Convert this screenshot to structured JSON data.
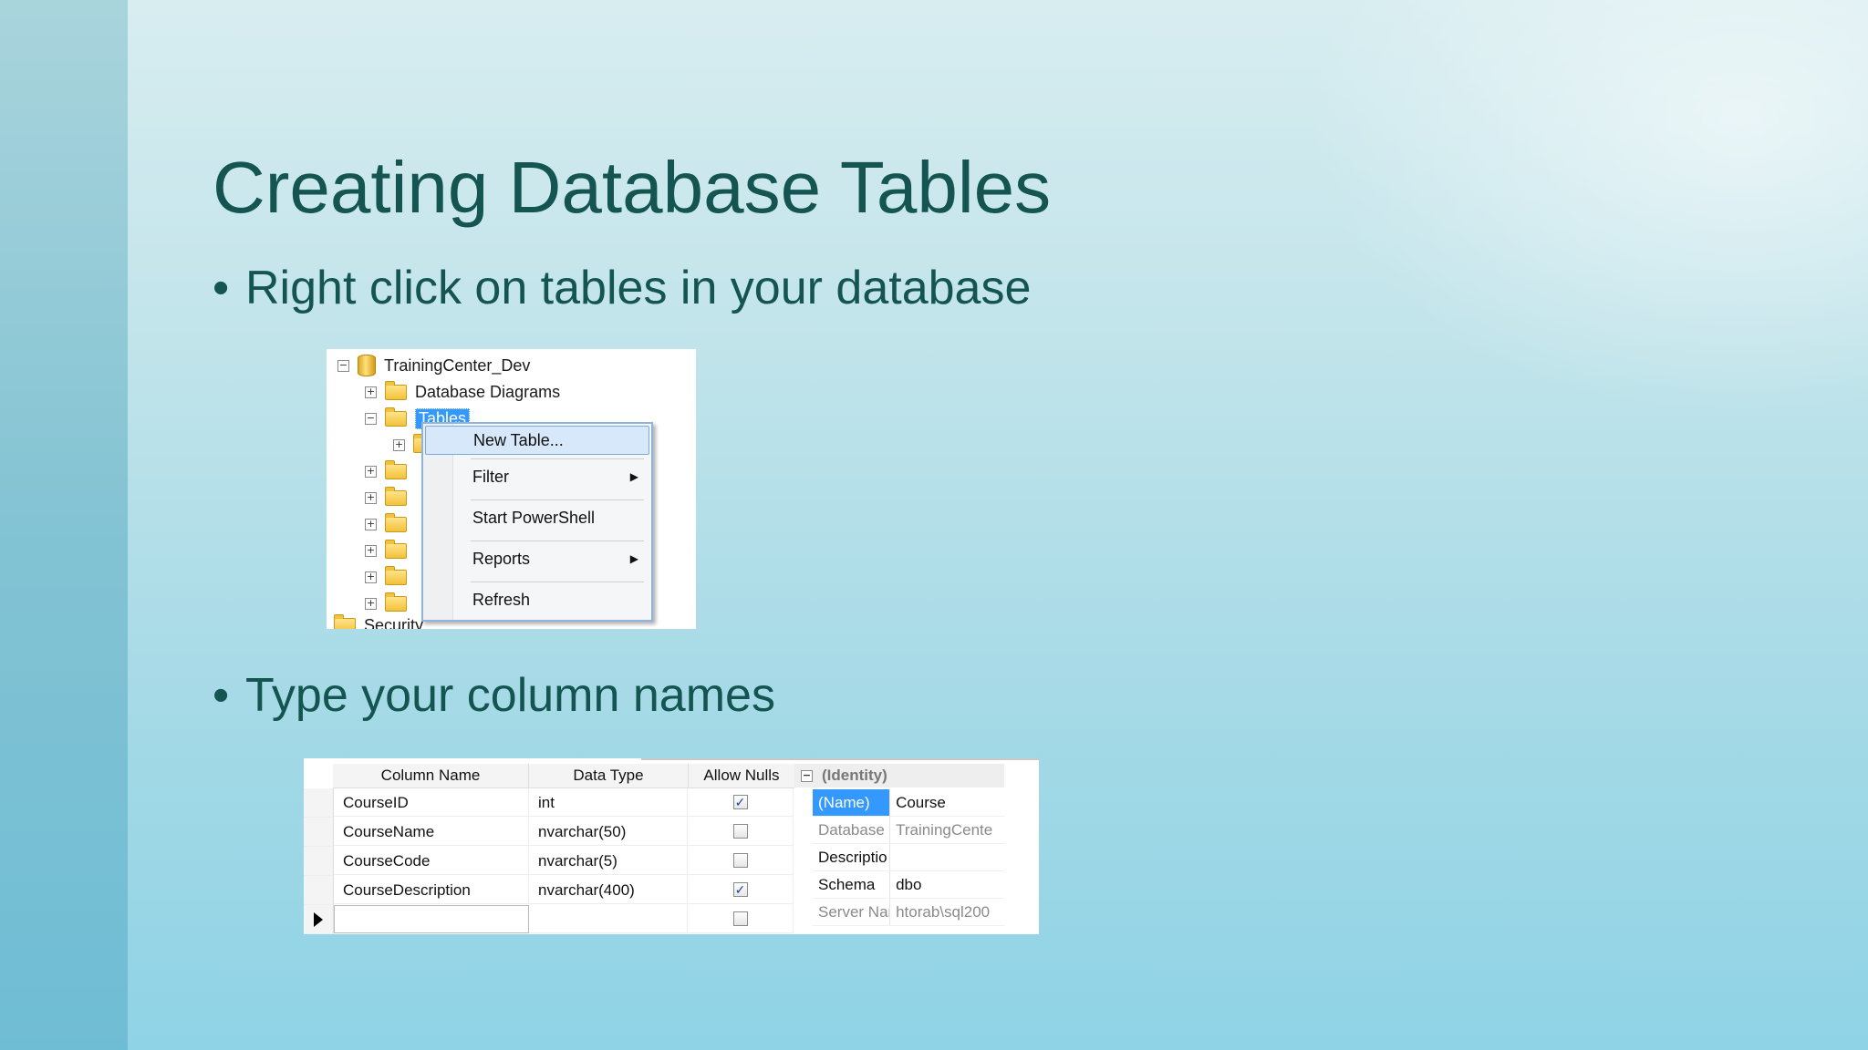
{
  "slide": {
    "title": "Creating Database Tables",
    "bullets": [
      "Right click on tables in your database",
      "Type your column names"
    ]
  },
  "object_explorer": {
    "database": "TrainingCenter_Dev",
    "nodes": {
      "diagrams": "Database Diagrams",
      "tables": "Tables",
      "security": "Security"
    },
    "context_menu": {
      "items": [
        "New Table...",
        "Filter",
        "Start PowerShell",
        "Reports",
        "Refresh"
      ]
    }
  },
  "table_designer": {
    "columns": [
      "Column Name",
      "Data Type",
      "Allow Nulls"
    ],
    "rows": [
      {
        "name": "CourseID",
        "type": "int",
        "nulls": true
      },
      {
        "name": "CourseName",
        "type": "nvarchar(50)",
        "nulls": false
      },
      {
        "name": "CourseCode",
        "type": "nvarchar(5)",
        "nulls": false
      },
      {
        "name": "CourseDescription",
        "type": "nvarchar(400)",
        "nulls": true
      }
    ],
    "properties": {
      "category": "(Identity)",
      "items": [
        {
          "key": "(Name)",
          "value": "Course"
        },
        {
          "key": "Database I",
          "value": "TrainingCente"
        },
        {
          "key": "Descriptio",
          "value": ""
        },
        {
          "key": "Schema",
          "value": "dbo"
        },
        {
          "key": "Server Nar",
          "value": "htorab\\sql200"
        }
      ]
    }
  },
  "glyphs": {
    "check": "✓",
    "submenu_arrow": "▶",
    "expand": "+",
    "collapse": "−"
  },
  "colors": {
    "title": "#145552",
    "selection": "#3399ff"
  }
}
